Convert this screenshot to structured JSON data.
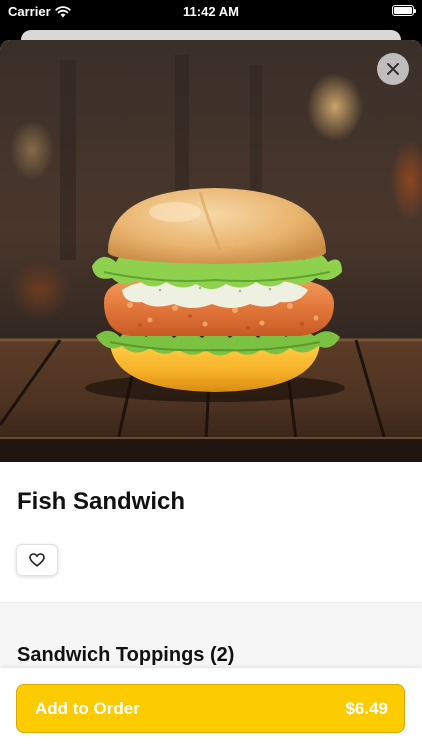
{
  "status_bar": {
    "carrier": "Carrier",
    "time": "11:42 AM",
    "wifi_icon": "wifi-icon",
    "battery_icon": "battery-icon"
  },
  "product": {
    "title": "Fish Sandwich",
    "image_subject": "fish-sandwich-photo",
    "favorite_icon": "heart-icon"
  },
  "close_icon": "close-icon",
  "section": {
    "title": "Sandwich Toppings (2)"
  },
  "order_button": {
    "label": "Add to Order",
    "price": "$6.49"
  },
  "colors": {
    "accent": "#fccb00",
    "button_text": "#ffffff",
    "title_text": "#111111",
    "section_background": "#f6f6f6"
  }
}
